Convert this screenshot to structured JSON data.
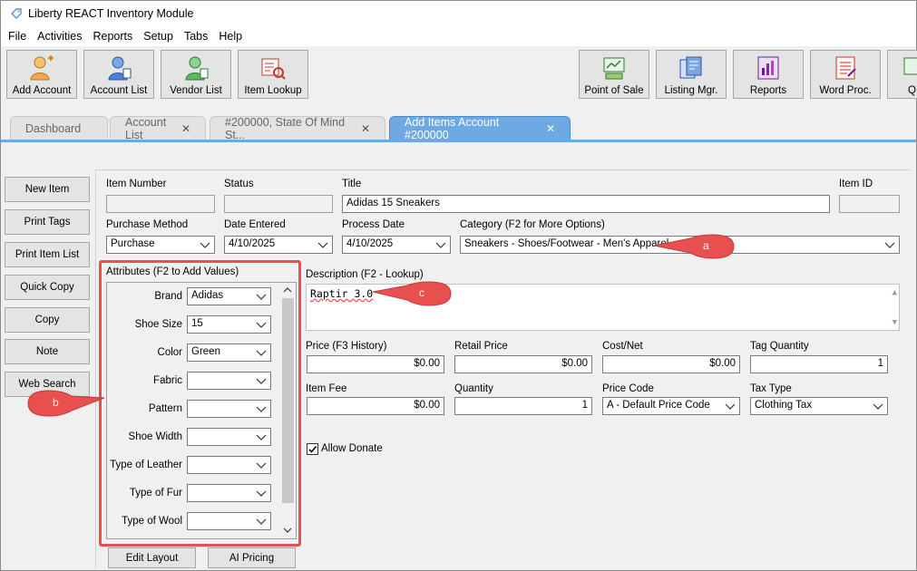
{
  "window": {
    "title": "Liberty REACT Inventory Module"
  },
  "menu": [
    "File",
    "Activities",
    "Reports",
    "Setup",
    "Tabs",
    "Help"
  ],
  "toolbar": {
    "left": [
      "Add Account",
      "Account List",
      "Vendor List",
      "Item Lookup"
    ],
    "right": [
      "Point of Sale",
      "Listing Mgr.",
      "Reports",
      "Word Proc.",
      "QB"
    ]
  },
  "tabs": [
    {
      "label": "Dashboard",
      "closable": false
    },
    {
      "label": "Account List",
      "closable": true
    },
    {
      "label": "#200000, State Of Mind St...",
      "closable": true
    },
    {
      "label": "Add Items Account #200000",
      "closable": true,
      "active": true
    }
  ],
  "side_buttons": [
    "New Item",
    "Print Tags",
    "Print Item List",
    "Quick Copy",
    "Copy",
    "Note",
    "Web Search"
  ],
  "form": {
    "item_number": {
      "label": "Item Number",
      "value": ""
    },
    "status": {
      "label": "Status",
      "value": ""
    },
    "title": {
      "label": "Title",
      "value": "Adidas 15 Sneakers"
    },
    "item_id": {
      "label": "Item ID",
      "value": ""
    },
    "purchase_method": {
      "label": "Purchase Method",
      "value": "Purchase"
    },
    "date_entered": {
      "label": "Date Entered",
      "value": "4/10/2025"
    },
    "process_date": {
      "label": "Process Date",
      "value": "4/10/2025"
    },
    "category": {
      "label": "Category (F2 for More Options)",
      "value": "Sneakers - Shoes/Footwear - Men's Apparel"
    },
    "attributes_label": "Attributes (F2 to Add Values)",
    "attributes": [
      {
        "label": "Brand",
        "value": "Adidas"
      },
      {
        "label": "Shoe Size",
        "value": "15"
      },
      {
        "label": "Color",
        "value": "Green"
      },
      {
        "label": "Fabric",
        "value": ""
      },
      {
        "label": "Pattern",
        "value": ""
      },
      {
        "label": "Shoe Width",
        "value": ""
      },
      {
        "label": "Type of Leather",
        "value": ""
      },
      {
        "label": "Type of Fur",
        "value": ""
      },
      {
        "label": "Type of Wool",
        "value": ""
      }
    ],
    "description": {
      "label": "Description (F2 - Lookup)",
      "value": "Raptir 3.0"
    },
    "price": {
      "label": "Price (F3 History)",
      "value": "$0.00"
    },
    "retail_price": {
      "label": "Retail Price",
      "value": "$0.00"
    },
    "cost_net": {
      "label": "Cost/Net",
      "value": "$0.00"
    },
    "tag_quantity": {
      "label": "Tag Quantity",
      "value": "1"
    },
    "item_fee": {
      "label": "Item Fee",
      "value": "$0.00"
    },
    "quantity": {
      "label": "Quantity",
      "value": "1"
    },
    "price_code": {
      "label": "Price Code",
      "value": "A - Default Price Code"
    },
    "tax_type": {
      "label": "Tax Type",
      "value": "Clothing Tax"
    },
    "allow_donate": {
      "label": "Allow Donate",
      "checked": true
    }
  },
  "bottom_buttons": [
    "Edit Layout",
    "AI Pricing"
  ],
  "callouts": [
    "a",
    "b",
    "c"
  ],
  "colors": {
    "tab_active": "#6fa9e3",
    "callout": "#e8504f"
  }
}
